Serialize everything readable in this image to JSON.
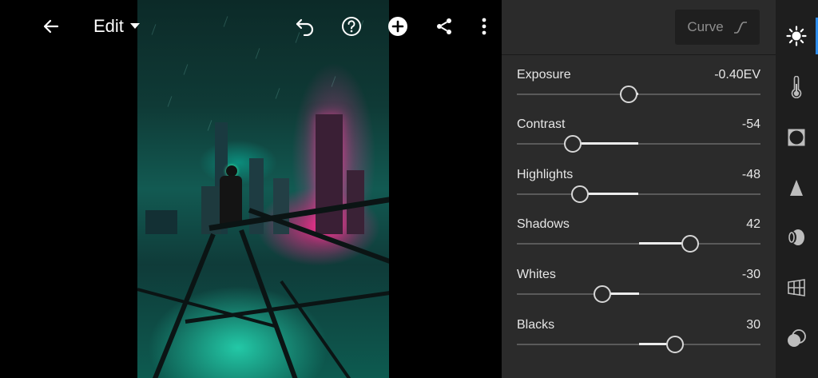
{
  "header": {
    "mode_label": "Edit"
  },
  "panel": {
    "curve_label": "Curve",
    "sliders": [
      {
        "label": "Exposure",
        "value": "-0.40EV",
        "fraction": 0.46
      },
      {
        "label": "Contrast",
        "value": "-54",
        "fraction": 0.23
      },
      {
        "label": "Highlights",
        "value": "-48",
        "fraction": 0.26
      },
      {
        "label": "Shadows",
        "value": "42",
        "fraction": 0.71
      },
      {
        "label": "Whites",
        "value": "-30",
        "fraction": 0.35
      },
      {
        "label": "Blacks",
        "value": "30",
        "fraction": 0.65
      }
    ]
  },
  "tools": [
    {
      "name": "light-icon",
      "active": true
    },
    {
      "name": "color-temperature-icon",
      "active": false
    },
    {
      "name": "vignette-icon",
      "active": false
    },
    {
      "name": "detail-icon",
      "active": false
    },
    {
      "name": "optics-icon",
      "active": false
    },
    {
      "name": "geometry-icon",
      "active": false
    },
    {
      "name": "blend-icon",
      "active": false
    }
  ],
  "colors": {
    "accent": "#2d8ceb",
    "panel_bg": "#2b2b2b",
    "toolbar_bg": "#1e1e1e"
  }
}
